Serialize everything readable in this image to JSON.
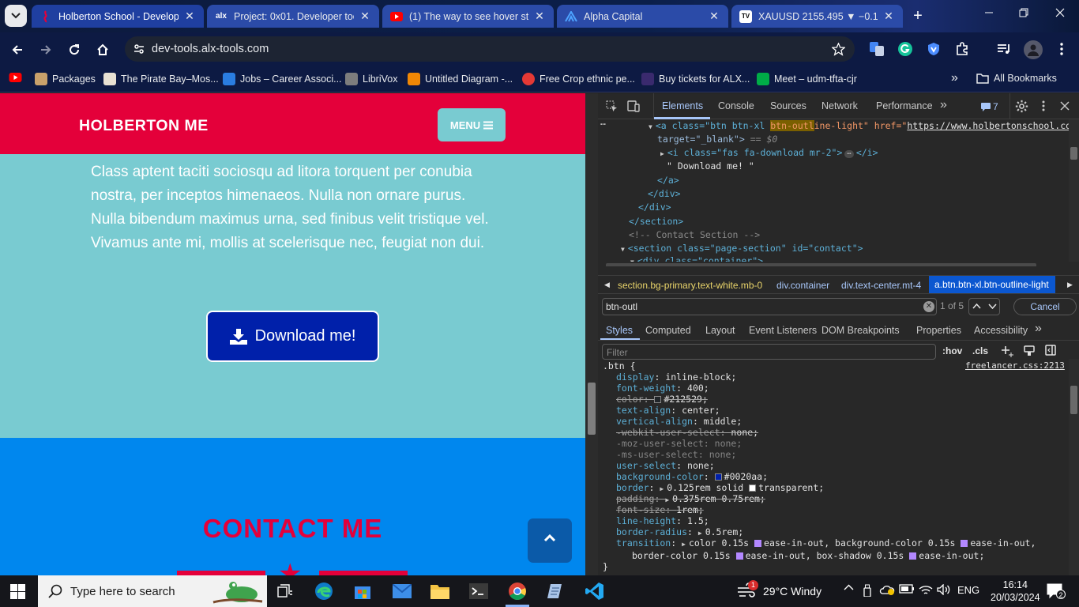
{
  "browser": {
    "tabs": [
      {
        "title": "Holberton School - Develope",
        "active": true
      },
      {
        "title": "Project: 0x01. Developer tool"
      },
      {
        "title": "(1) The way to see hover stat"
      },
      {
        "title": "Alpha Capital"
      },
      {
        "title": "XAUUSD 2155.495 ▼ −0.1%"
      }
    ],
    "url": "dev-tools.alx-tools.com",
    "bookmarks": [
      "Packages",
      "The Pirate Bay–Mos...",
      "Jobs – Career Associ...",
      "LibriVox",
      "Untitled Diagram -...",
      "Free Crop ethnic pe...",
      "Buy tickets for ALX...",
      "Meet – udm-tfta-cjr"
    ],
    "all_bookmarks": "All Bookmarks",
    "favicon_labels": {
      "alx": "alx",
      "tv": "TV"
    }
  },
  "page": {
    "brand": "HOLBERTON ME",
    "menu_label": "MENU",
    "paragraph": "Class aptent taciti sociosqu ad litora torquent per conubia nostra, per inceptos himenaeos. Nulla non ornare purus. Nulla bibendum maximus urna, sed finibus velit tristique vel. Vivamus ante mi, mollis at scelerisque nec, feugiat non dui.",
    "download_label": "Download me!",
    "contact_title": "CONTACT ME",
    "colors": {
      "navbar": "#e4003a",
      "section": "#79cbd1",
      "button": "#0020aa",
      "contact_bg": "#0087ee"
    }
  },
  "devtools": {
    "tabs": [
      "Elements",
      "Console",
      "Sources",
      "Network",
      "Performance"
    ],
    "issues_count": "7",
    "dom_lines": {
      "a_open_1": "<a class=\"btn btn-xl ",
      "a_highlight": "btn-outl",
      "a_open_2": "ine-light\" href=\"",
      "a_href": "https://www.holbertonschool.com",
      "a_open_3": "\"",
      "a_target": "target=\"_blank\">",
      "a_eq": " == $0",
      "i_tag": "<i class=\"fas fa-download mr-2\">",
      "i_close": "</i>",
      "text": "\" Download me! \"",
      "a_close": "</a>",
      "div_close_1": "</div>",
      "div_close_2": "</div>",
      "section_close": "</section>",
      "comment": "<!-- Contact Section -->",
      "section_open": "<section class=\"page-section\" id=\"contact\">",
      "div_partial": "<div class=\"container\">"
    },
    "breadcrumbs": [
      "section.bg-primary.text-white.mb-0",
      "div.container",
      "div.text-center.mt-4",
      "a.btn.btn-xl.btn-outline-light"
    ],
    "search": {
      "value": "btn-outl",
      "count": "1 of 5",
      "cancel": "Cancel"
    },
    "style_tabs": [
      "Styles",
      "Computed",
      "Layout",
      "Event Listeners",
      "DOM Breakpoints",
      "Properties",
      "Accessibility"
    ],
    "filter_placeholder": "Filter",
    "hov": ":hov",
    "cls": ".cls",
    "rule": {
      "selector": ".btn {",
      "source": "freelancer.css:2213",
      "close": "}"
    },
    "props": [
      {
        "name": "display",
        "value": "inline-block;"
      },
      {
        "name": "font-weight",
        "value": "400;"
      },
      {
        "name": "color",
        "value": "#212529;",
        "struck": true,
        "swatch": "#212529"
      },
      {
        "name": "text-align",
        "value": "center;"
      },
      {
        "name": "vertical-align",
        "value": "middle;"
      },
      {
        "name": "-webkit-user-select",
        "value": "none;",
        "struck": true
      },
      {
        "name": "-moz-user-select",
        "value": "none;",
        "dim": true
      },
      {
        "name": "-ms-user-select",
        "value": "none;",
        "dim": true
      },
      {
        "name": "user-select",
        "value": "none;"
      },
      {
        "name": "background-color",
        "value": "#0020aa;",
        "swatch": "#0020aa"
      },
      {
        "name": "border",
        "value": "0.125rem solid",
        "value2": "transparent;",
        "expand": true,
        "swatch2": "#ffffff"
      },
      {
        "name": "padding",
        "value": "0.375rem 0.75rem;",
        "struck": true,
        "expand": true
      },
      {
        "name": "font-size",
        "value": "1rem;",
        "struck": true
      },
      {
        "name": "line-height",
        "value": "1.5;"
      },
      {
        "name": "border-radius",
        "value": "0.5rem;",
        "expand": true
      },
      {
        "name": "transition",
        "value": "color 0.15s",
        "expand": true
      }
    ],
    "transition_rest_1": "ease-in-out, background-color 0.15s",
    "transition_rest_2": "ease-in-out,",
    "transition_line2a": "border-color 0.15s",
    "transition_line2b": "ease-in-out, box-shadow 0.15s",
    "transition_line2c": "ease-in-out;"
  },
  "taskbar": {
    "search_placeholder": "Type here to search",
    "weather": "29°C  Windy",
    "badge": "1",
    "lang": "ENG",
    "time": "16:14",
    "date": "20/03/2024",
    "notifications": "2"
  }
}
